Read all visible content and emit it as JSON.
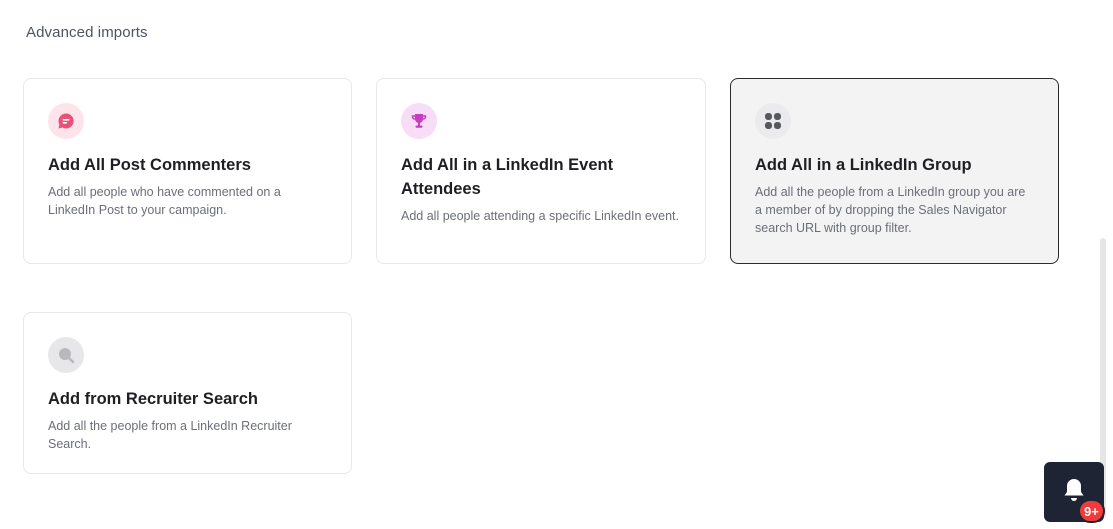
{
  "section_title": "Advanced imports",
  "cards": [
    {
      "title": "Add All Post Commenters",
      "description": "Add all people who have commented on a LinkedIn Post to your campaign.",
      "icon": "comment-icon",
      "icon_bg": "#fde3ea",
      "icon_color": "#e8517a"
    },
    {
      "title": "Add All in a LinkedIn Event Attendees",
      "description": "Add all people attending a specific LinkedIn event.",
      "icon": "trophy-icon",
      "icon_bg": "#f8ddf6",
      "icon_color": "#c63fc0"
    },
    {
      "title": "Add All in a LinkedIn Group",
      "description": "Add all the people from a LinkedIn group you are a member of by dropping the Sales Navigator search URL with group filter.",
      "icon": "group-grid-icon",
      "icon_bg": "#ebebed",
      "icon_color": "#55585e"
    },
    {
      "title": "Add from Recruiter Search",
      "description": "Add all the people from a LinkedIn Recruiter Search.",
      "icon": "search-icon",
      "icon_bg": "#e7e7e9",
      "icon_color": "#b8b9bd"
    }
  ],
  "notification": {
    "badge": "9+",
    "icon": "bell-icon",
    "badge_color": "#ef3b3b"
  }
}
